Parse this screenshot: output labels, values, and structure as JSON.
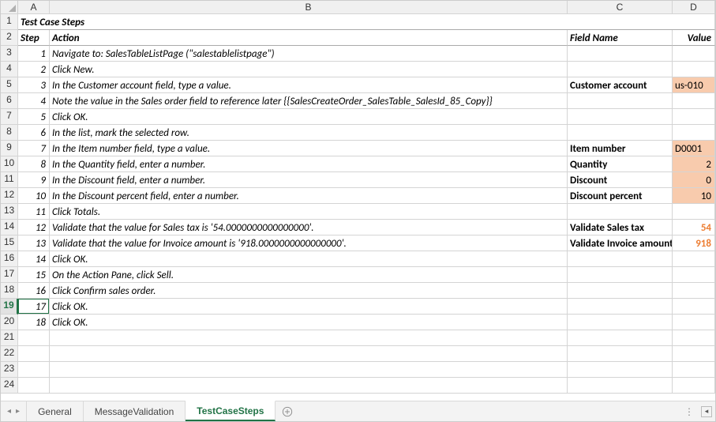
{
  "columns": [
    "A",
    "B",
    "C",
    "D"
  ],
  "row_count": 24,
  "selected_row": 19,
  "title": "Test Case Steps",
  "headers": {
    "step": "Step",
    "action": "Action",
    "field": "Field Name",
    "value": "Value"
  },
  "rows": [
    {
      "step": 1,
      "action": "Navigate to: SalesTableListPage (\"salestablelistpage\")"
    },
    {
      "step": 2,
      "action": "Click New."
    },
    {
      "step": 3,
      "action": "In the Customer account field, type a value.",
      "field": "Customer account",
      "value": "us-010",
      "value_style": "fill"
    },
    {
      "step": 4,
      "action": "Note the value in the Sales order field to reference later {{SalesCreateOrder_SalesTable_SalesId_85_Copy}}"
    },
    {
      "step": 5,
      "action": "Click OK."
    },
    {
      "step": 6,
      "action": "In the list, mark the selected row."
    },
    {
      "step": 7,
      "action": "In the Item number field, type a value.",
      "field": "Item number",
      "value": "D0001",
      "value_style": "fill"
    },
    {
      "step": 8,
      "action": "In the Quantity field, enter a number.",
      "field": "Quantity",
      "value": "2",
      "value_style": "fill-right"
    },
    {
      "step": 9,
      "action": "In the Discount field, enter a number.",
      "field": "Discount",
      "value": "0",
      "value_style": "fill-right"
    },
    {
      "step": 10,
      "action": "In the Discount percent field, enter a number.",
      "field": "Discount percent",
      "value": "10",
      "value_style": "fill-right"
    },
    {
      "step": 11,
      "action": "Click Totals."
    },
    {
      "step": 12,
      "action": "Validate that the value for Sales tax is '54.0000000000000000'.",
      "field": "Validate Sales tax",
      "value": "54",
      "value_style": "validate"
    },
    {
      "step": 13,
      "action": "Validate that the value for Invoice amount is '918.0000000000000000'.",
      "field": "Validate Invoice amount",
      "value": "918",
      "value_style": "validate"
    },
    {
      "step": 14,
      "action": "Click OK."
    },
    {
      "step": 15,
      "action": "On the Action Pane, click Sell."
    },
    {
      "step": 16,
      "action": "Click Confirm sales order."
    },
    {
      "step": 17,
      "action": "Click OK."
    },
    {
      "step": 18,
      "action": "Click OK."
    }
  ],
  "tabs": {
    "items": [
      "General",
      "MessageValidation",
      "TestCaseSteps"
    ],
    "active": 2
  }
}
